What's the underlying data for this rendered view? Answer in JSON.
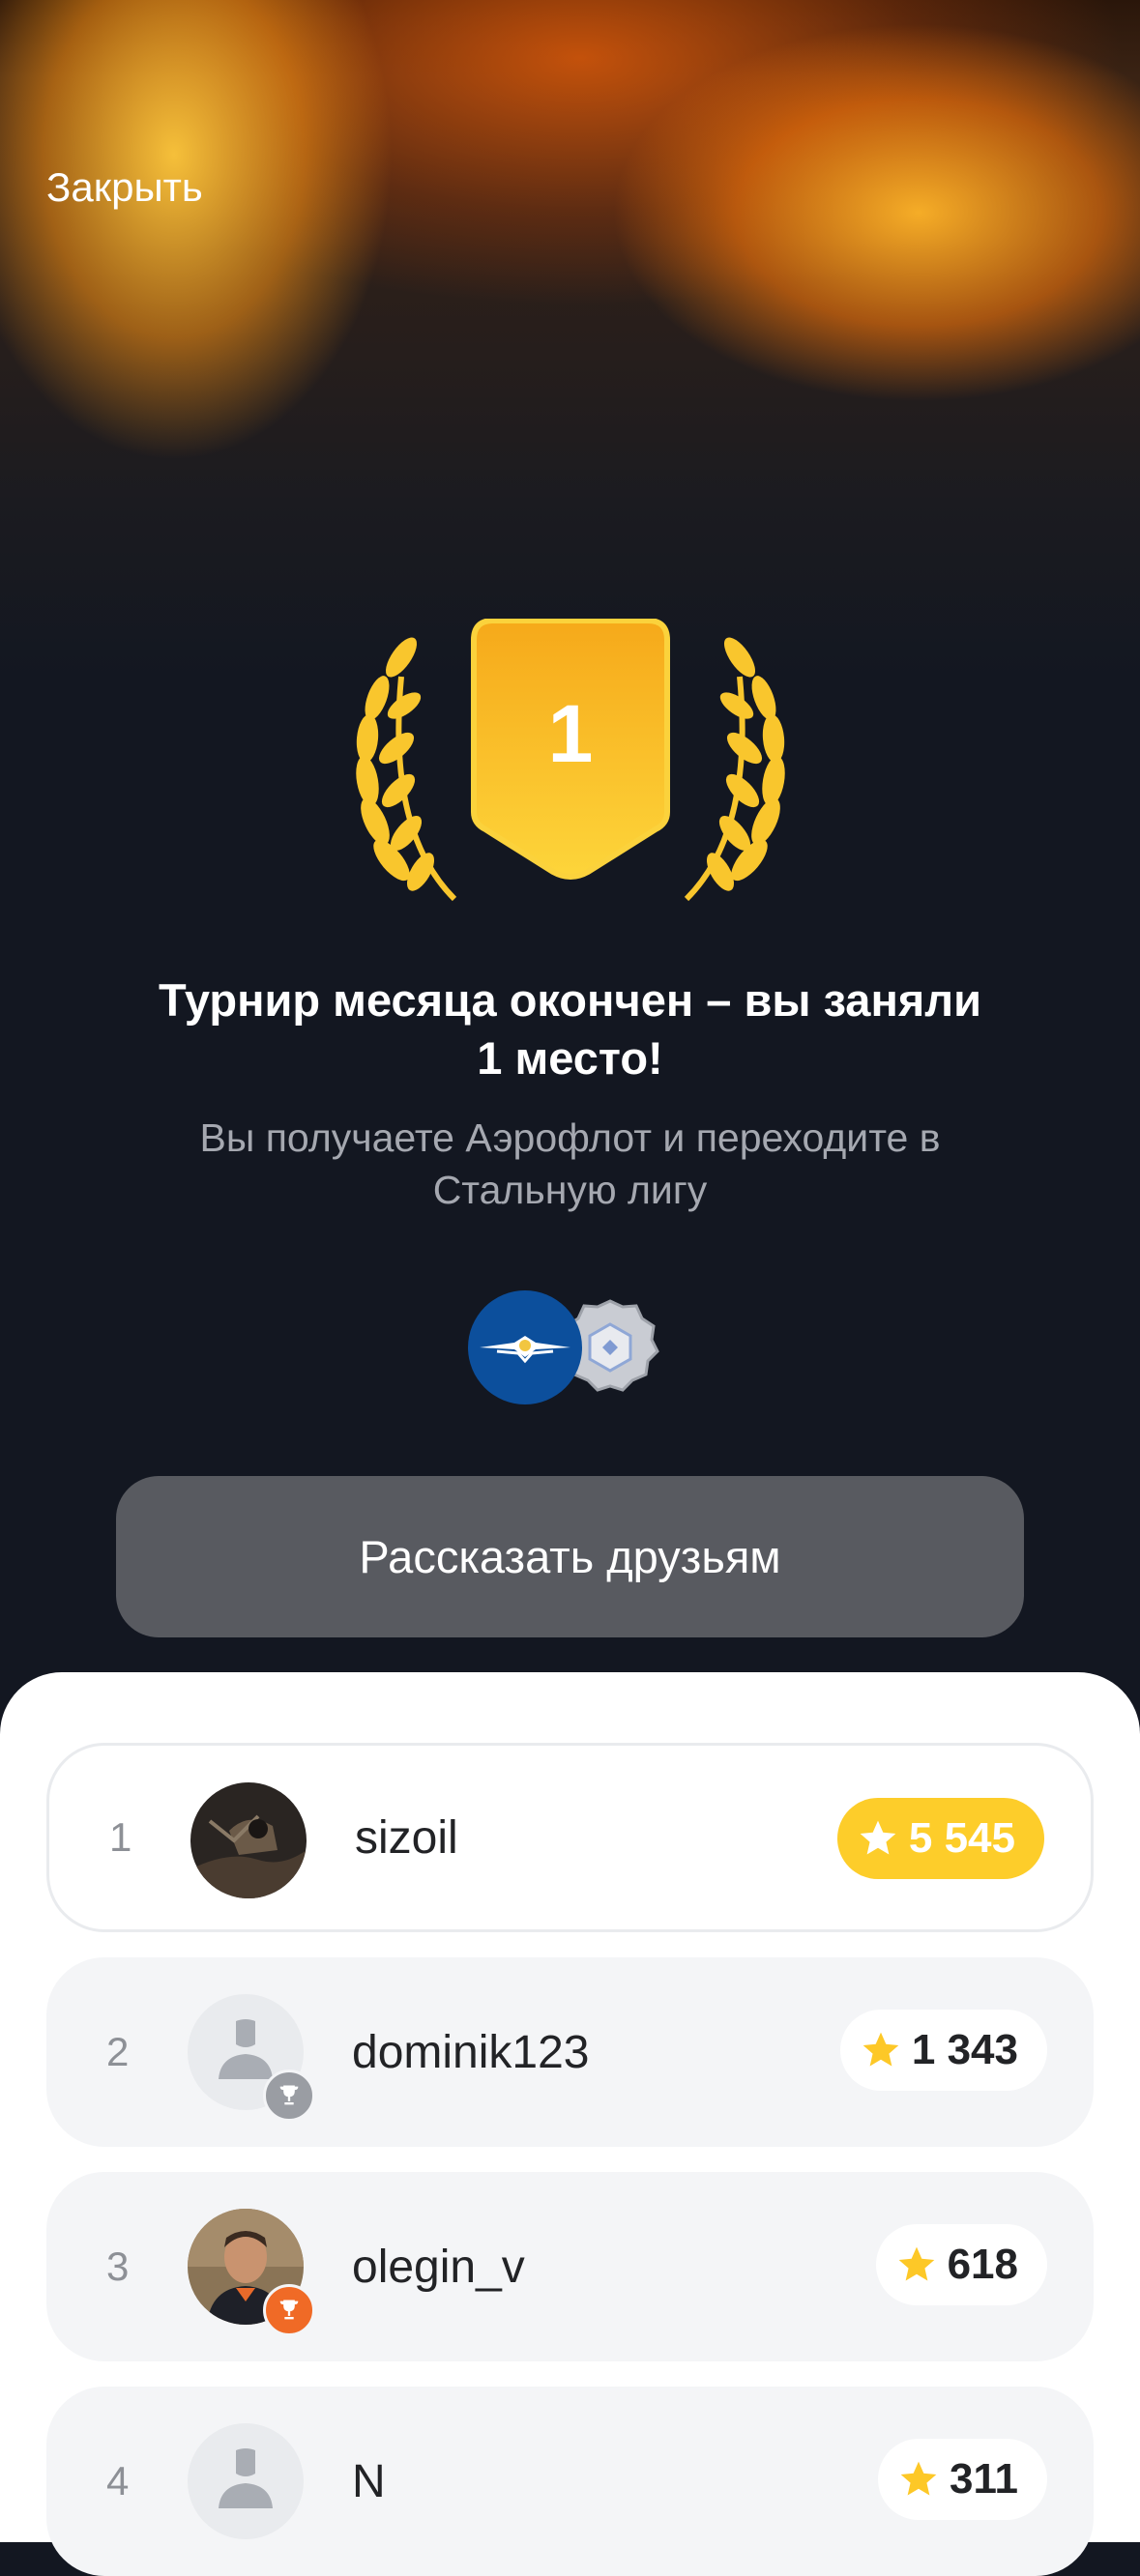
{
  "header": {
    "close_label": "Закрыть"
  },
  "trophy": {
    "place": "1",
    "color": "#f8bd1c"
  },
  "message": {
    "title_line1": "Турнир месяца окончен – вы заняли",
    "title_line2": "1 место!",
    "subtitle_line1": "Вы получаете Аэрофлот и переходите в",
    "subtitle_line2": "Стальную лигу"
  },
  "rewards": [
    {
      "icon": "aeroflot-logo-icon",
      "color": "#0c4f9c"
    },
    {
      "icon": "steel-league-badge-icon",
      "color": "#c9ccd3"
    }
  ],
  "share_button": {
    "label": "Рассказать друзьям"
  },
  "leaderboard": {
    "rows": [
      {
        "rank": "1",
        "username": "sizoil",
        "score": "5 545",
        "avatar": "photo",
        "highlight": true
      },
      {
        "rank": "2",
        "username": "dominik123",
        "score": "1 343",
        "avatar": "placeholder",
        "cup": "silver"
      },
      {
        "rank": "3",
        "username": "olegin_v",
        "score": "618",
        "avatar": "photo",
        "cup": "bronze"
      },
      {
        "rank": "4",
        "username": "N",
        "score": "311",
        "avatar": "placeholder"
      }
    ]
  },
  "colors": {
    "accent_gold": "#fdcd2a",
    "bronze": "#f06a26",
    "silver": "#9a9da3"
  }
}
